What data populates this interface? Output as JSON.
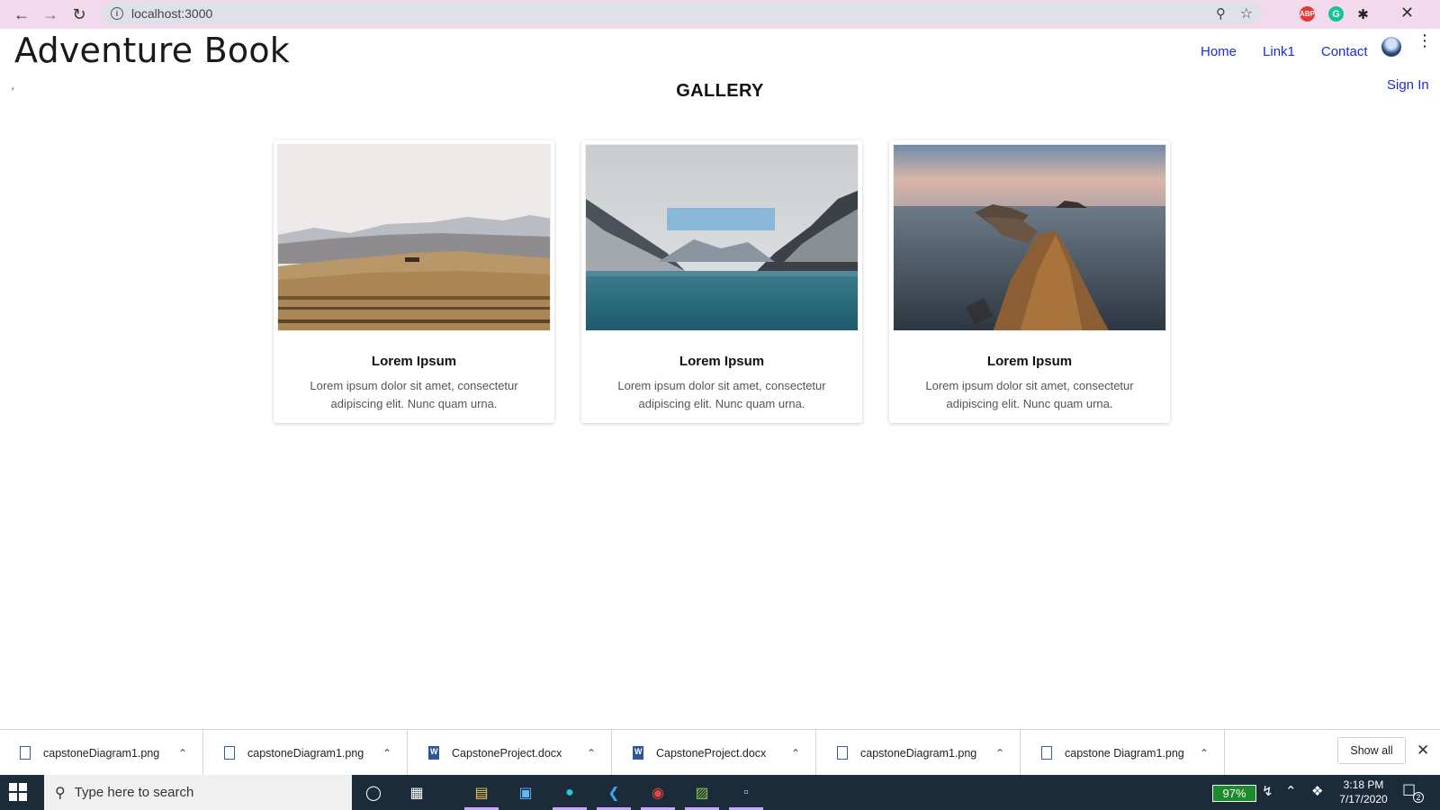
{
  "browser": {
    "url": "localhost:3000",
    "extensions": [
      "adblock-icon",
      "grammarly-icon",
      "extensions-puzzle-icon"
    ]
  },
  "site": {
    "brand": "Adventure Book",
    "nav": [
      {
        "label": "Home"
      },
      {
        "label": "Link1"
      },
      {
        "label": "Contact"
      }
    ],
    "signin": "Sign In"
  },
  "gallery": {
    "title": "GALLERY",
    "cards": [
      {
        "image": "meadow-hills-photo",
        "title": "Lorem Ipsum",
        "text": "Lorem ipsum dolor sit amet, consectetur adipiscing elit. Nunc quam urna."
      },
      {
        "image": "mountain-lake-photo",
        "title": "Lorem Ipsum",
        "text": "Lorem ipsum dolor sit amet, consectetur adipiscing elit. Nunc quam urna."
      },
      {
        "image": "sea-cliffs-photo",
        "title": "Lorem Ipsum",
        "text": "Lorem ipsum dolor sit amet, consectetur adipiscing elit. Nunc quam urna."
      }
    ]
  },
  "downloads": {
    "items": [
      {
        "name": "capstoneDiagram1.png",
        "type": "image"
      },
      {
        "name": "capstoneDiagram1.png",
        "type": "image"
      },
      {
        "name": "CapstoneProject.docx",
        "type": "word"
      },
      {
        "name": "CapstoneProject.docx",
        "type": "word"
      },
      {
        "name": "capstoneDiagram1.png",
        "type": "image"
      },
      {
        "name": "capstone Diagram1.png",
        "type": "image"
      }
    ],
    "show_all": "Show all"
  },
  "taskbar": {
    "search_placeholder": "Type here to search",
    "battery": "97%",
    "time": "3:18 PM",
    "date": "7/17/2020",
    "notifications": "2"
  },
  "colors": {
    "link": "#1d2bd1",
    "chrome_frame": "#f3d9ec",
    "taskbar": "#1c2b3a"
  }
}
